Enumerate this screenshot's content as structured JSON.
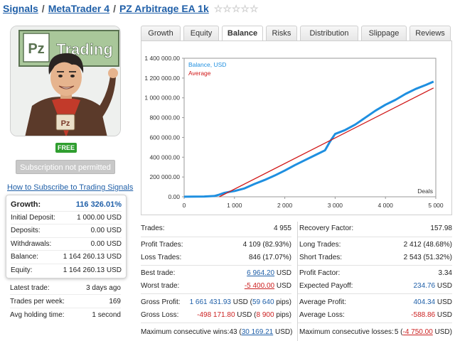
{
  "breadcrumb": {
    "signals": "Signals",
    "platform": "MetaTrader 4",
    "name": "PZ Arbitrage EA 1k",
    "separator": "/"
  },
  "avatar": {
    "sign_pz": "Pz",
    "sign_trading": "Trading",
    "shirt_text": "Pz"
  },
  "badge_free": "FREE",
  "subscribe_button": "Subscription not permitted",
  "how_to_link": "How to Subscribe to Trading Signals",
  "summary": {
    "growth_label": "Growth:",
    "growth_value": "116 326.01%",
    "initial_label": "Initial Deposit:",
    "initial_value": "1 000.00 USD",
    "deposits_label": "Deposits:",
    "deposits_value": "0.00 USD",
    "withdrawals_label": "Withdrawals:",
    "withdrawals_value": "0.00 USD",
    "balance_label": "Balance:",
    "balance_value": "1 164 260.13 USD",
    "equity_label": "Equity:",
    "equity_value": "1 164 260.13 USD"
  },
  "activity": {
    "latest_label": "Latest trade:",
    "latest_value": "3 days ago",
    "perweek_label": "Trades per week:",
    "perweek_value": "169",
    "holding_label": "Avg holding time:",
    "holding_value": "1 second"
  },
  "tabs": [
    "Growth",
    "Equity",
    "Balance",
    "Risks",
    "Distribution",
    "Slippage",
    "Reviews"
  ],
  "active_tab": "Balance",
  "metrics_left": {
    "trades_label": "Trades:",
    "trades_value": "4 955",
    "profit_trades_label": "Profit Trades:",
    "profit_trades_value": "4 109 (82.93%)",
    "loss_trades_label": "Loss Trades:",
    "loss_trades_value": "846 (17.07%)",
    "best_label": "Best trade:",
    "best_num": "6 964.20",
    "best_unit": " USD",
    "worst_label": "Worst trade:",
    "worst_num": "-5 400.00",
    "worst_unit": " USD",
    "gross_profit_label": "Gross Profit:",
    "gross_profit_num": "1 661 431.93",
    "gross_profit_mid": " USD (",
    "gross_profit_pips": "59 640",
    "gross_profit_end": " pips)",
    "gross_loss_label": "Gross Loss:",
    "gross_loss_num": "-498 171.80",
    "gross_loss_mid": " USD (",
    "gross_loss_pips": "8 900",
    "gross_loss_end": " pips)",
    "max_wins_label": "Maximum consecutive wins:",
    "max_wins_count": "43 (",
    "max_wins_num": "30 169.21",
    "max_wins_end": " USD)"
  },
  "metrics_right": {
    "recovery_label": "Recovery Factor:",
    "recovery_value": "157.98",
    "long_label": "Long Trades:",
    "long_value": "2 412 (48.68%)",
    "short_label": "Short Trades:",
    "short_value": "2 543 (51.32%)",
    "pf_label": "Profit Factor:",
    "pf_value": "3.34",
    "payoff_label": "Expected Payoff:",
    "payoff_num": "234.76",
    "payoff_unit": " USD",
    "avg_profit_label": "Average Profit:",
    "avg_profit_num": "404.34",
    "avg_profit_unit": " USD",
    "avg_loss_label": "Average Loss:",
    "avg_loss_num": "-588.86",
    "avg_loss_unit": " USD",
    "max_losses_label": "Maximum consecutive losses:",
    "max_losses_count": "5 (",
    "max_losses_num": "-4 750.00",
    "max_losses_end": " USD)"
  },
  "colors": {
    "link": "#1f5fa8",
    "negative": "#cc2222",
    "balance_line": "#1e8fe0",
    "average_line": "#d01818",
    "free_badge": "#2f9e2f"
  },
  "chart_data": {
    "type": "line",
    "xlabel": "Deals",
    "x_ticks": [
      "0",
      "1 000",
      "2 000",
      "3 000",
      "4 000",
      "5 000"
    ],
    "y_ticks": [
      "0.00",
      "200 000.00",
      "400 000.00",
      "600 000.00",
      "800 000.00",
      "1 000 000.00",
      "1 200 000.00",
      "1 400 000.00"
    ],
    "xlim": [
      0,
      5000
    ],
    "ylim": [
      0,
      1400000
    ],
    "grid": false,
    "legend": "top-left",
    "series": [
      {
        "name": "Balance, USD",
        "x": [
          0,
          200,
          400,
          600,
          700,
          800,
          900,
          1000,
          1200,
          1400,
          1600,
          1800,
          2000,
          2200,
          2400,
          2600,
          2800,
          2900,
          3000,
          3200,
          3400,
          3600,
          3800,
          4000,
          4200,
          4400,
          4600,
          4800,
          4955
        ],
        "y": [
          1000,
          1500,
          3000,
          8000,
          22000,
          40000,
          50000,
          58000,
          85000,
          130000,
          170000,
          215000,
          265000,
          320000,
          370000,
          420000,
          470000,
          560000,
          635000,
          675000,
          730000,
          800000,
          870000,
          930000,
          980000,
          1040000,
          1090000,
          1130000,
          1164260
        ]
      },
      {
        "name": "Average",
        "x": [
          700,
          4955
        ],
        "y": [
          0,
          1100000
        ]
      }
    ]
  }
}
